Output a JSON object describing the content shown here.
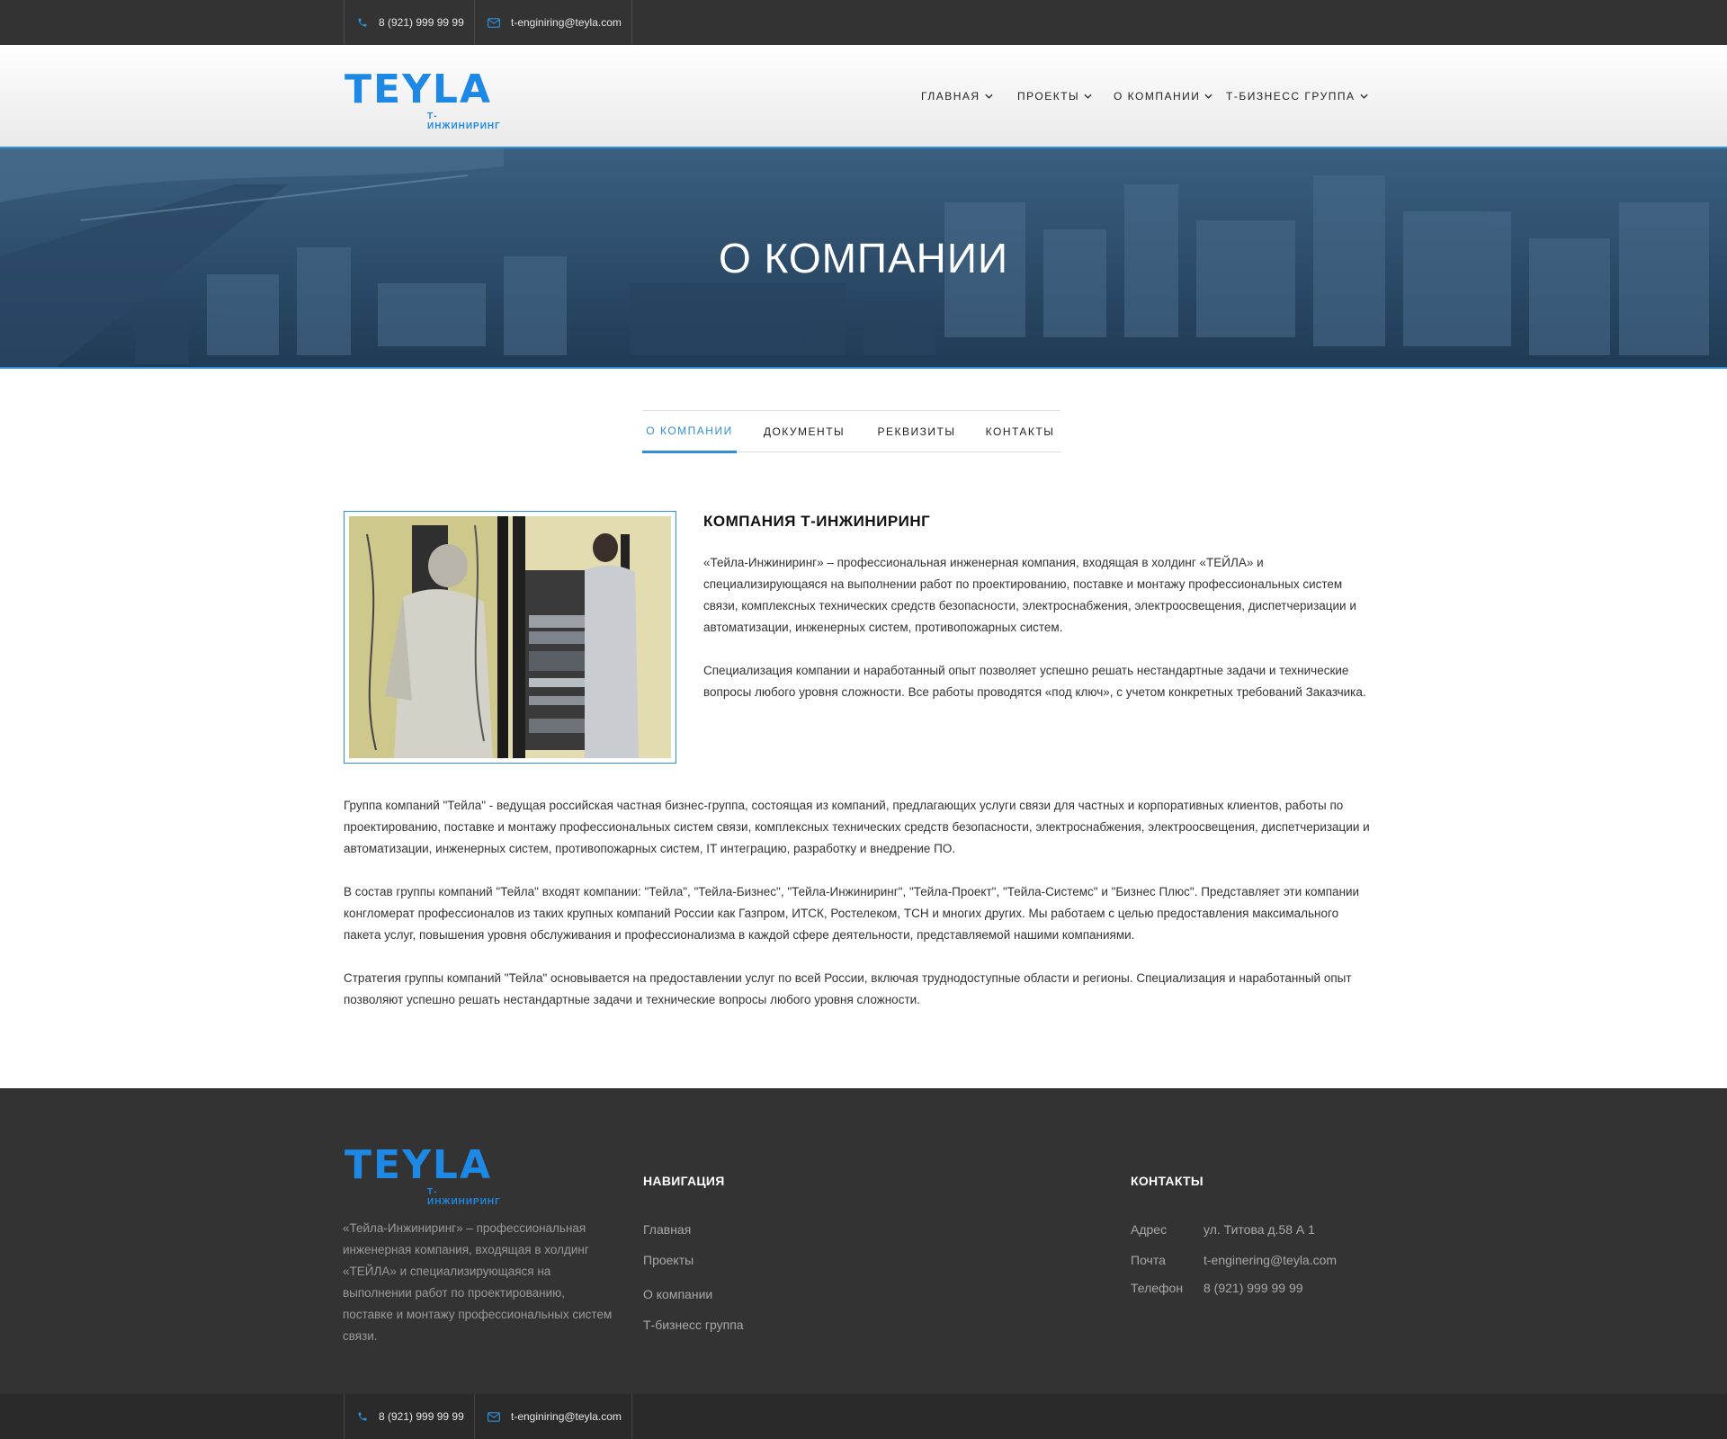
{
  "topbar": {
    "phone": "8 (921) 999 99 99",
    "email": "t-enginiring@teyla.com"
  },
  "logo": {
    "word": "TEYLA",
    "sub": "Т-ИНЖИНИРИНГ"
  },
  "nav": {
    "items": [
      "ГЛАВНАЯ",
      "ПРОЕКТЫ",
      "О КОМПАНИИ",
      "Т-БИЗНЕСС ГРУППА"
    ]
  },
  "hero": {
    "title": "О КОМПАНИИ"
  },
  "tabs": {
    "items": [
      "О КОМПАНИИ",
      "ДОКУМЕНТЫ",
      "РЕКВИЗИТЫ",
      "КОНТАКТЫ"
    ],
    "active": "О КОМПАНИИ"
  },
  "about": {
    "title": "КОМПАНИЯ Т-ИНЖИНИРИНГ",
    "p1": "«Тейла-Инжиниринг» – профессиональная инженерная компания, входящая в холдинг «ТЕЙЛА» и специализирующаяся на выполнении работ по проектированию, поставке и монтажу профессиональных систем связи, комплексных технических средств безопасности, электроснабжения, электроосвещения, диспетчеризации и автоматизации, инженерных систем, противопожарных систем.",
    "p2": "Специализация компании и наработанный опыт позволяет успешно решать нестандартные задачи и технические вопросы  любого уровня сложности. Все работы проводятся «под ключ», с учетом конкретных требований Заказчика.",
    "p3": "Группа компаний \"Тейла\" - ведущая российская частная бизнес-группа, состоящая из компаний, предлагающих услуги связи для частных и корпоративных клиентов, работы по проектированию, поставке и монтажу профессиональных систем связи, комплексных технических средств безопасности, электроснабжения, электроосвещения, диспетчеризации и автоматизации, инженерных систем, противопожарных систем, IT интеграцию, разработку и внедрение ПО.",
    "p4": "В состав группы компаний \"Тейла\" входят компании: \"Тейла\", \"Тейла-Бизнес\", \"Тейла-Инжиниринг\", \"Тейла-Проект\", \"Тейла-Системс\" и \"Бизнес Плюс\". Представляет эти компании конгломерат профессионалов из таких крупных компаний России как Газпром, ИТСК, Ростелеком, ТСН и многих других. Мы работаем с целью предоставления максимального пакета услуг, повышения уровня обслуживания и профессионализма в каждой сфере деятельности, представляемой нашими компаниями.",
    "p5": "Стратегия группы компаний \"Тейла\" основывается на предоставлении услуг по всей России, включая труднодоступные области и регионы. Специализация и наработанный опыт позволяют успешно решать нестандартные задачи и технические вопросы любого уровня сложности."
  },
  "footer": {
    "desc": "«Тейла-Инжиниринг» – профессиональная инженерная компания, входящая в холдинг «ТЕЙЛА» и специализирующаяся на выполнении работ по проектированию, поставке и монтажу профессиональных систем связи.",
    "nav_title": "НАВИГАЦИЯ",
    "nav_links": [
      "Главная",
      "Проекты",
      "О компании",
      "Т-бизнесс группа"
    ],
    "contacts_title": "КОНТАКТЫ",
    "contacts": [
      {
        "label": "Адрес",
        "value": "ул. Титова д.58 А 1"
      },
      {
        "label": "Почта",
        "value": "t-enginering@teyla.com"
      },
      {
        "label": "Телефон",
        "value": "8 (921) 999 99 99"
      }
    ]
  },
  "bottombar": {
    "phone": "8 (921) 999 99 99",
    "email": "t-enginiring@teyla.com"
  },
  "colors": {
    "accent": "#2f8fd8",
    "dark": "#333333",
    "logo": "#1e88e5"
  },
  "icons": [
    "phone-icon",
    "mail-icon",
    "chevron-down-icon"
  ]
}
